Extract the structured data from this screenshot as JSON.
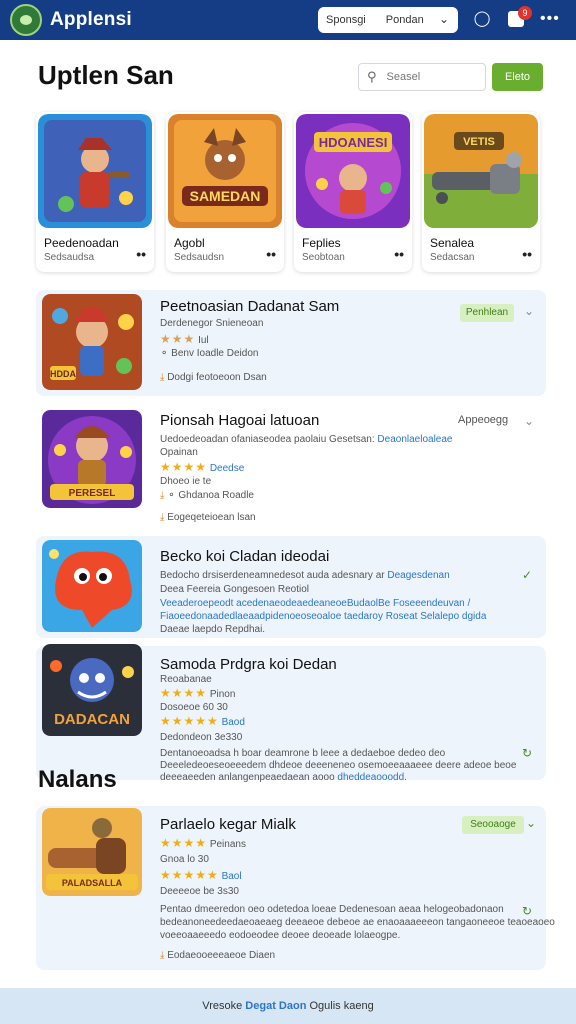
{
  "header": {
    "title": "Applensi",
    "select_left": "Sponsgi",
    "select_right": "Pondan",
    "notification_count": "9"
  },
  "heading": {
    "title": "Uptlen San",
    "search_placeholder": "Seasel",
    "go_label": "Eleto"
  },
  "featured": [
    {
      "name": "Peedenoadan",
      "sub": "Sedsaudsa"
    },
    {
      "name": "Agobl",
      "sub": "Sedsaudsn"
    },
    {
      "name": "Feplies",
      "sub": "Seobtoan"
    },
    {
      "name": "Senalea",
      "sub": "Sedacsan"
    }
  ],
  "list": [
    {
      "title": "Peetnoasian Dadanat Sam",
      "line1": "Derdenegor Snieneoan",
      "rating_note": "Iul",
      "line3": "Benv Ioadle Deidon",
      "download": "Dodgi feotoeoon Dsan",
      "pill": "Penhlean",
      "thumb_art": "HDDA"
    },
    {
      "title": "Pionsah Hagoai latuoan",
      "line1a": "Uedoedeoadan ofaniaseodea  paolaiu Gesetsan:",
      "line1b": "Deaonlaeloaleae",
      "line2": "Opainan",
      "stars_note": "Deedse",
      "line3": "Dhoeo ie te",
      "line4": "Ghdanoa Roadle",
      "download": "Eogeqeteioean lsan",
      "right_label": "Appeoegg",
      "thumb_art": "PERESEL"
    },
    {
      "title": "Becko koi Cladan ideodai",
      "line1a": "Bedocho drsiserdeneamnedesot auda adesnary ar",
      "line1b": "Deagesdenan",
      "line2": "Deea Feereia Gongesoen Reotiol",
      "line3": "Veeaderoepeodt acedenaeodeaedeaneoeBudaolBe Foseeendeuvan /",
      "line4": "Fiaoeedonaadedlaeaadpidenoeoseoaloe taedaroy Roseat Selalepo dgida",
      "line5": "Daeae laepdo Repdhai."
    },
    {
      "title": "Samoda Prdgra koi Dedan",
      "line1": "Reoabanae",
      "stars1_note": "Pinon",
      "line2": "Dosoeoe 60 30",
      "stars2_note": "Baod",
      "line3": "Dedondeon 3e330",
      "line4": "Dentanoeoadsa h boar deamrone b leee  a  dedaeboe dedeo deo",
      "line5": "Deeeledeoeseoeeedem dhdeoe deeeneneo osemoeeaaaeee deere adeoe beoe",
      "line6": "deeeaeeden  anlangenpeaedaean aooo",
      "line6b": "dheddeaooodd.",
      "thumb_art": "DADACAN"
    }
  ],
  "section": {
    "title": "Nalans"
  },
  "list2": [
    {
      "title": "Parlaelo kegar Mialk",
      "stars1_note": "Peinans",
      "line2": "Gnoa lo 30",
      "stars2_note": "Baol",
      "line3": "Deeeeoe be 3s30",
      "line4": "Pentao dmeeredon oeo odetedoa loeae Dedenesoan aeaa  helogeobadonaon",
      "line5": "bedeanoneedeedaeoaeaeg deeaeoe debeoe ae enaoaaaeeeon tangaoneeoe teaoeaoeo",
      "line6": "voeeoaaeeedo eodoeodee deoee deoeade lolaeogpe.",
      "download": "Eodaeooeeeaeoe Diaen",
      "pill": "Seooaoge",
      "thumb_art": "PALADSALLA"
    }
  ],
  "footer": {
    "pre": "Vresoke",
    "link": "Degat Daon",
    "post": "Ogulis kaeng"
  }
}
